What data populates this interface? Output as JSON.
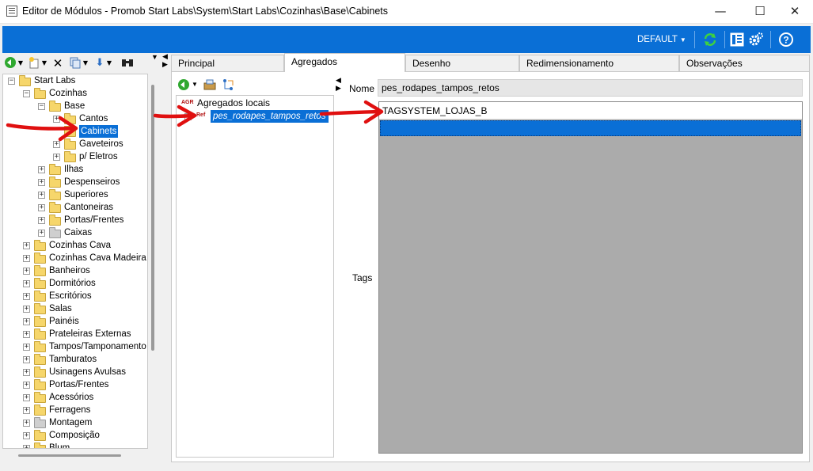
{
  "window": {
    "title": "Editor de Módulos - Promob Start Labs\\System\\Start Labs\\Cozinhas\\Base\\Cabinets",
    "minimize": "—",
    "maximize": "☐",
    "close": "✕"
  },
  "toolbar": {
    "default_label": "DEFAULT",
    "icons": [
      "refresh-icon",
      "layout-icon",
      "settings-icon",
      "help-icon"
    ]
  },
  "left_toolbar": {
    "icons": [
      "back-icon",
      "new-icon",
      "delete-icon",
      "copy-icon",
      "move-icon",
      "binoculars-icon"
    ]
  },
  "tree": {
    "items": [
      {
        "label": "Start Labs",
        "level": 0,
        "toggle": "−",
        "gray": false
      },
      {
        "label": "Cozinhas",
        "level": 1,
        "toggle": "−",
        "gray": false
      },
      {
        "label": "Base",
        "level": 2,
        "toggle": "−",
        "gray": false
      },
      {
        "label": "Cantos",
        "level": 3,
        "toggle": "+",
        "gray": false
      },
      {
        "label": "Cabinets",
        "level": 3,
        "toggle": "",
        "gray": false,
        "selected": true
      },
      {
        "label": "Gaveteiros",
        "level": 3,
        "toggle": "+",
        "gray": false
      },
      {
        "label": "p/ Eletros",
        "level": 3,
        "toggle": "+",
        "gray": false
      },
      {
        "label": "Ilhas",
        "level": 2,
        "toggle": "+",
        "gray": false
      },
      {
        "label": "Despenseiros",
        "level": 2,
        "toggle": "+",
        "gray": false
      },
      {
        "label": "Superiores",
        "level": 2,
        "toggle": "+",
        "gray": false
      },
      {
        "label": "Cantoneiras",
        "level": 2,
        "toggle": "+",
        "gray": false
      },
      {
        "label": "Portas/Frentes",
        "level": 2,
        "toggle": "+",
        "gray": false
      },
      {
        "label": "Caixas",
        "level": 2,
        "toggle": "+",
        "gray": true
      },
      {
        "label": "Cozinhas Cava",
        "level": 1,
        "toggle": "+",
        "gray": false
      },
      {
        "label": "Cozinhas Cava Madeira",
        "level": 1,
        "toggle": "+",
        "gray": false
      },
      {
        "label": "Banheiros",
        "level": 1,
        "toggle": "+",
        "gray": false
      },
      {
        "label": "Dormitórios",
        "level": 1,
        "toggle": "+",
        "gray": false
      },
      {
        "label": "Escritórios",
        "level": 1,
        "toggle": "+",
        "gray": false
      },
      {
        "label": "Salas",
        "level": 1,
        "toggle": "+",
        "gray": false
      },
      {
        "label": "Painéis",
        "level": 1,
        "toggle": "+",
        "gray": false
      },
      {
        "label": "Prateleiras Externas",
        "level": 1,
        "toggle": "+",
        "gray": false
      },
      {
        "label": "Tampos/Tamponamento",
        "level": 1,
        "toggle": "+",
        "gray": false
      },
      {
        "label": "Tamburatos",
        "level": 1,
        "toggle": "+",
        "gray": false
      },
      {
        "label": "Usinagens Avulsas",
        "level": 1,
        "toggle": "+",
        "gray": false
      },
      {
        "label": "Portas/Frentes",
        "level": 1,
        "toggle": "+",
        "gray": false
      },
      {
        "label": "Acessórios",
        "level": 1,
        "toggle": "+",
        "gray": false
      },
      {
        "label": "Ferragens",
        "level": 1,
        "toggle": "+",
        "gray": false
      },
      {
        "label": "Montagem",
        "level": 1,
        "toggle": "+",
        "gray": true
      },
      {
        "label": "Composição",
        "level": 1,
        "toggle": "+",
        "gray": false
      },
      {
        "label": "Blum",
        "level": 1,
        "toggle": "+",
        "gray": false
      }
    ]
  },
  "tabs": [
    {
      "label": "Principal",
      "active": false
    },
    {
      "label": "Agregados",
      "active": true
    },
    {
      "label": "Desenho",
      "active": false
    },
    {
      "label": "Redimensionamento",
      "active": false
    },
    {
      "label": "Observações",
      "active": false
    }
  ],
  "agregados": {
    "root_tag": "AGR",
    "root_label": "Agregados locais",
    "child_tag": "Ref",
    "child_label": "pes_rodapes_tampos_retos"
  },
  "details": {
    "nome_label": "Nome",
    "nome_value": "pes_rodapes_tampos_retos",
    "tags_label": "Tags",
    "tags": [
      "TAGSYSTEM_LOJAS_B",
      ""
    ]
  },
  "colors": {
    "accent": "#0a6fd6",
    "arrow": "#e01010",
    "folder": "#f6d66b"
  }
}
